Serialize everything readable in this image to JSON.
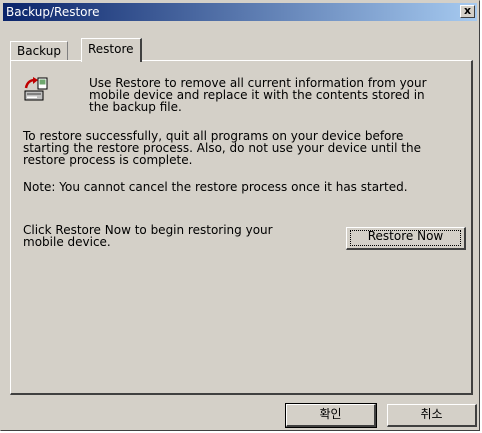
{
  "window": {
    "title": "Backup/Restore",
    "close_label": "x"
  },
  "tabs": [
    {
      "label": "Backup",
      "selected": false
    },
    {
      "label": "Restore",
      "selected": true
    }
  ],
  "restore_tab": {
    "icon": "restore-to-device-icon",
    "intro_lines": [
      "Use Restore to remove all current information from your",
      "mobile device and replace it with the contents stored in",
      "the backup file."
    ],
    "instruction_lines": [
      "To restore successfully, quit all programs on your device before",
      "starting the restore process. Also, do not use your device until the",
      "restore process is complete."
    ],
    "note": "Note: You cannot cancel the restore process once it has started.",
    "click_hint_lines": [
      "Click Restore Now to begin restoring your",
      "mobile device."
    ],
    "restore_now_label": "Restore Now"
  },
  "dialog_buttons": {
    "ok_label": "확인",
    "cancel_label": "취소"
  },
  "colors": {
    "titlebar_start": "#0a246a",
    "titlebar_end": "#a6caf0",
    "face": "#d4d0c8"
  }
}
